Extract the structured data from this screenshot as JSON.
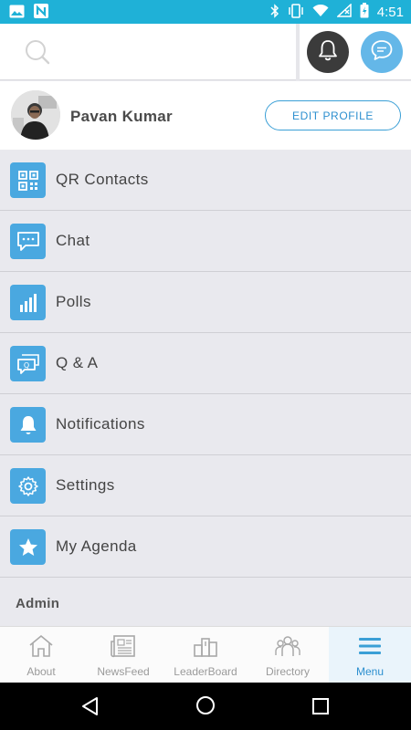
{
  "status_bar": {
    "time": "4:51",
    "icons": [
      "image-icon",
      "n-app-icon",
      "bluetooth-icon",
      "vibrate-icon",
      "wifi-icon",
      "no-signal-icon",
      "battery-charging-icon"
    ]
  },
  "header": {
    "search_icon": "search-icon",
    "bell_icon": "bell-icon",
    "chat_icon": "chat-bubble-icon"
  },
  "profile": {
    "name": "Pavan Kumar",
    "edit_label": "EDIT PROFILE"
  },
  "menu": {
    "items": [
      {
        "label": "QR Contacts",
        "icon": "qr-code-icon"
      },
      {
        "label": "Chat",
        "icon": "chat-icon"
      },
      {
        "label": "Polls",
        "icon": "bar-chart-icon"
      },
      {
        "label": "Q & A",
        "icon": "qa-icon"
      },
      {
        "label": "Notifications",
        "icon": "bell-icon"
      },
      {
        "label": "Settings",
        "icon": "gear-icon"
      },
      {
        "label": "My Agenda",
        "icon": "star-icon"
      }
    ],
    "section_title": "Admin"
  },
  "tabs": [
    {
      "label": "About",
      "icon": "house-icon"
    },
    {
      "label": "NewsFeed",
      "icon": "newspaper-icon"
    },
    {
      "label": "LeaderBoard",
      "icon": "leaderboard-icon"
    },
    {
      "label": "Directory",
      "icon": "people-icon"
    },
    {
      "label": "Menu",
      "icon": "hamburger-icon",
      "active": true
    }
  ],
  "colors": {
    "status_bar": "#1fb1d7",
    "accent": "#4aa8e0",
    "background": "#e9e9ee"
  }
}
